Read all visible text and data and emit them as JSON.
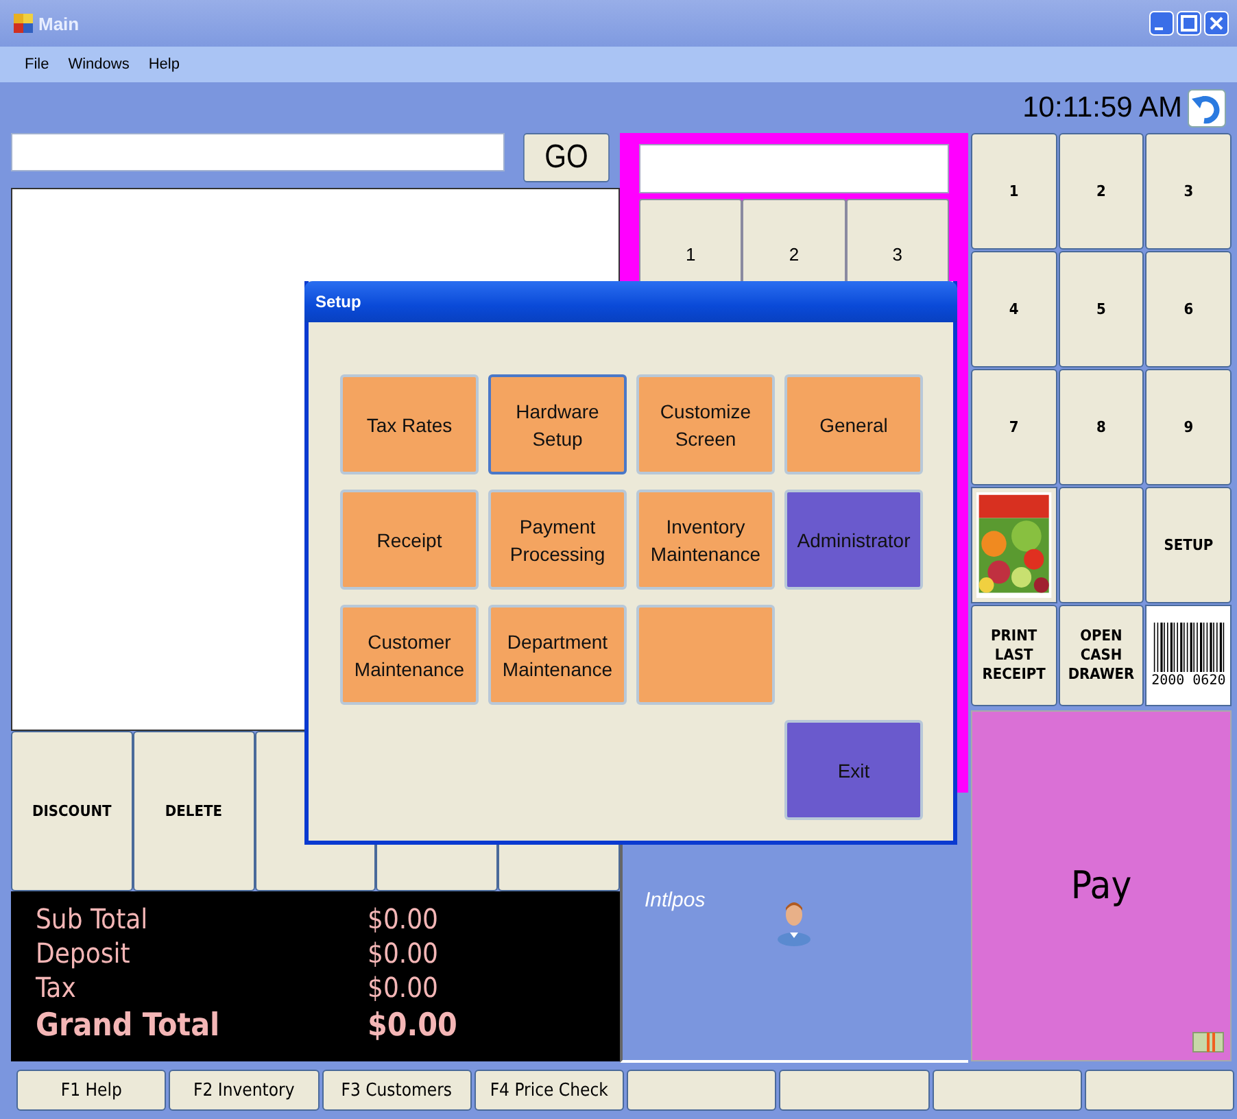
{
  "window": {
    "title": "Main"
  },
  "menu": [
    "File",
    "Windows",
    "Help"
  ],
  "clock": "10:11:59 AM",
  "search": {
    "button": "GO"
  },
  "action_buttons": [
    {
      "kind": "text",
      "label": "DISCOUNT"
    },
    {
      "kind": "text",
      "label": "DELETE"
    },
    {
      "kind": "blank"
    },
    {
      "kind": "blank"
    },
    {
      "kind": "blank"
    }
  ],
  "totals": [
    {
      "label": "Sub Total",
      "value": "$0.00",
      "kind": "normal"
    },
    {
      "label": "Deposit",
      "value": "$0.00",
      "kind": "normal"
    },
    {
      "label": "Tax",
      "value": "$0.00",
      "kind": "normal"
    },
    {
      "label": "Grand Total",
      "value": "$0.00",
      "kind": "grand"
    }
  ],
  "entry_keypad": [
    "1",
    "2",
    "3"
  ],
  "brand": "Intlpos",
  "keys": [
    {
      "kind": "key",
      "label": "1"
    },
    {
      "kind": "key",
      "label": "2"
    },
    {
      "kind": "key",
      "label": "3"
    },
    {
      "kind": "key",
      "label": "4"
    },
    {
      "kind": "key",
      "label": "5"
    },
    {
      "kind": "key",
      "label": "6"
    },
    {
      "kind": "key",
      "label": "7"
    },
    {
      "kind": "key",
      "label": "8"
    },
    {
      "kind": "key",
      "label": "9"
    },
    {
      "kind": "picture"
    },
    {
      "kind": "key"
    },
    {
      "kind": "key",
      "label": "SETUP"
    },
    {
      "kind": "key",
      "label": "PRINT LAST RECEIPT"
    },
    {
      "kind": "key",
      "label": "OPEN CASH DRAWER"
    },
    {
      "kind": "barcode",
      "label": "2000 0620"
    }
  ],
  "pay": "Pay",
  "function_keys": [
    {
      "kind": "text",
      "label": "F1 Help"
    },
    {
      "kind": "text",
      "label": "F2 Inventory"
    },
    {
      "kind": "text",
      "label": "F3 Customers"
    },
    {
      "kind": "text",
      "label": "F4 Price Check"
    },
    {
      "kind": "blank"
    },
    {
      "kind": "blank"
    },
    {
      "kind": "blank"
    },
    {
      "kind": "blank"
    }
  ],
  "setup": {
    "title": "Setup",
    "buttons": [
      {
        "label": "Tax Rates",
        "color": "#f4a460",
        "focused": false
      },
      {
        "label": "Hardware Setup",
        "color": "#f4a460",
        "focused": true
      },
      {
        "label": "Customize Screen",
        "color": "#f4a460",
        "focused": false
      },
      {
        "label": "General",
        "color": "#f4a460",
        "focused": false
      },
      {
        "label": "Receipt",
        "color": "#f4a460",
        "focused": false
      },
      {
        "label": "Payment Processing",
        "color": "#f4a460",
        "focused": false
      },
      {
        "label": "Inventory Maintenance",
        "color": "#f4a460",
        "focused": false
      },
      {
        "label": "Administrator",
        "color": "#6a5acd",
        "focused": false
      },
      {
        "label": "Customer Maintenance",
        "color": "#f4a460",
        "focused": false
      },
      {
        "label": "Department Maintenance",
        "color": "#f4a460",
        "focused": false
      },
      {
        "color": "#f4a460",
        "focused": false
      }
    ],
    "exit": {
      "label": "Exit",
      "color": "#6a5acd"
    }
  }
}
